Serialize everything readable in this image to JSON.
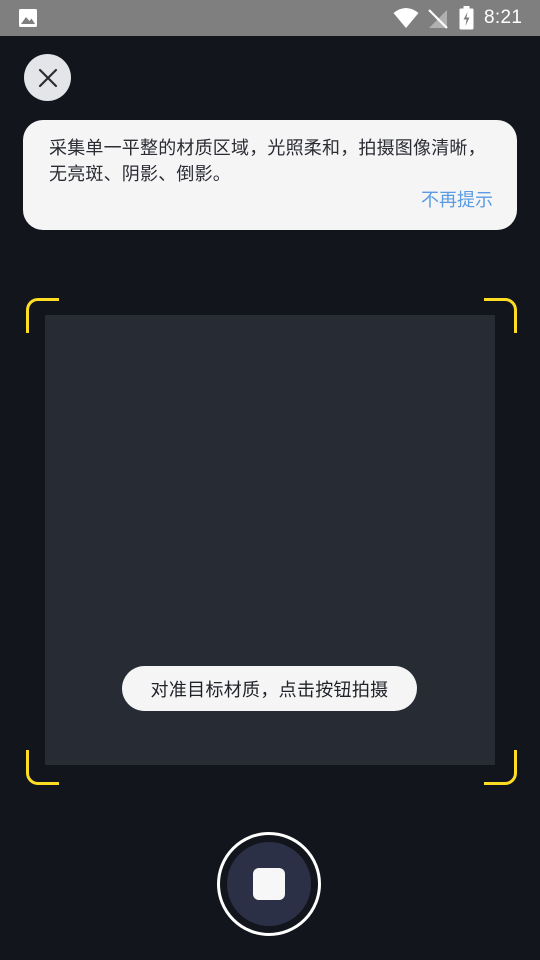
{
  "status_bar": {
    "time": "8:21",
    "icons": [
      "gallery-icon",
      "wifi-icon",
      "no-signal-icon",
      "battery-charging-icon"
    ]
  },
  "header": {
    "close_icon": "close-icon"
  },
  "tip": {
    "text": "采集单一平整的材质区域，光照柔和，拍摄图像清晰，无亮斑、阴影、倒影。",
    "dismiss_label": "不再提示"
  },
  "scanner": {
    "hint": "对准目标材质，点击按钮拍摄",
    "frame_color": "#ffdd22"
  },
  "colors": {
    "background": "#13151c",
    "accent_link": "#5a9be3",
    "shutter_inner": "#2c3046"
  }
}
